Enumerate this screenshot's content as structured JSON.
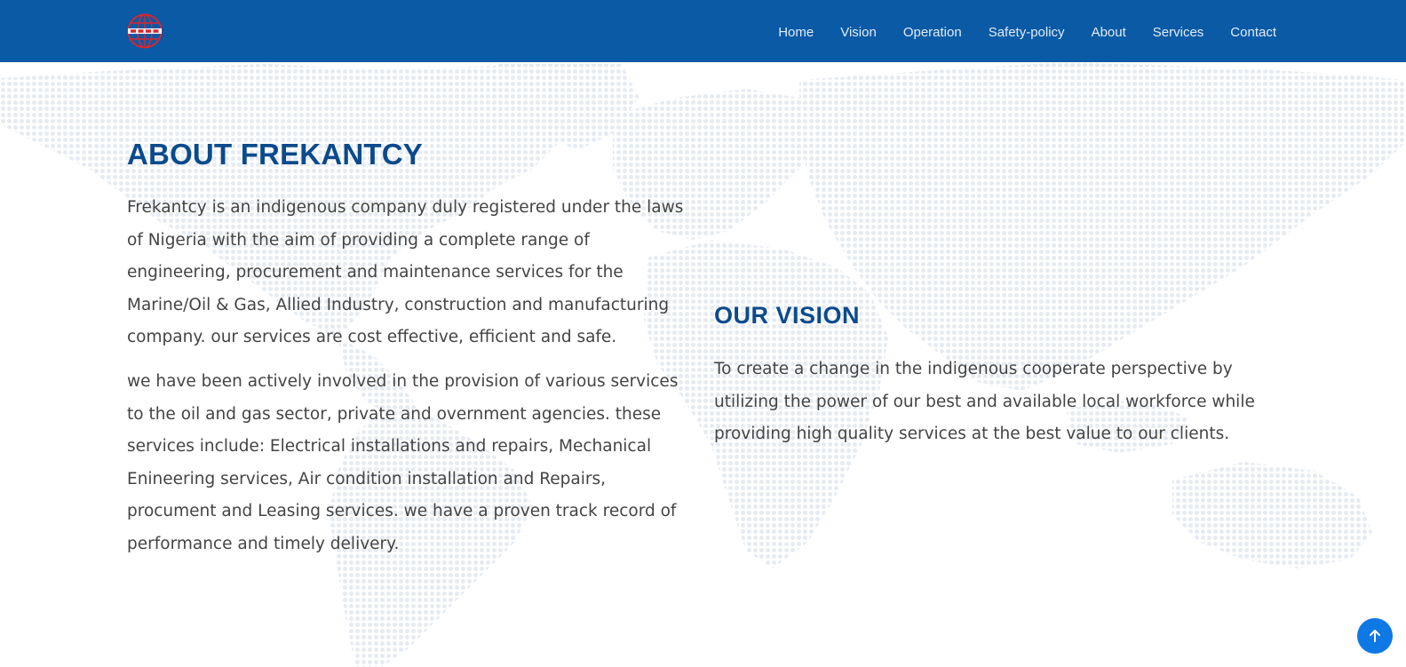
{
  "navbar": {
    "background_color": "#0a5aa6",
    "logo_icon": "globe-logo-icon",
    "items": [
      {
        "label": "Home"
      },
      {
        "label": "Vision"
      },
      {
        "label": "Operation"
      },
      {
        "label": "Safety-policy"
      },
      {
        "label": "About"
      },
      {
        "label": "Services"
      },
      {
        "label": "Contact"
      }
    ]
  },
  "about": {
    "title": "ABOUT FREKANTCY",
    "paragraph_1": "Frekantcy is an indigenous company duly registered under the laws of Nigeria with the aim of providing a complete range of engineering, procurement and maintenance services for the Marine/Oil & Gas, Allied Industry, construction and manufacturing company. our services are cost effective, efficient and safe.",
    "paragraph_2": "we have been actively involved in the provision of various services to the oil and gas sector, private and overnment agencies. these services include: Electrical installations and repairs, Mechanical Enineering services, Air condition installation and Repairs, procument and Leasing services. we have a proven track record of performance and timely delivery."
  },
  "vision": {
    "title": "OUR VISION",
    "text": "To create a change in the indigenous cooperate perspective by utilizing the power of our best and available local workforce while providing high quality services at the best value to our clients."
  },
  "back_to_top": {
    "icon": "arrow-up-icon",
    "color": "#0e78e4"
  },
  "colors": {
    "heading": "#0b4a8c",
    "body_text": "#444444",
    "map_dots": "#e6ebf2"
  }
}
